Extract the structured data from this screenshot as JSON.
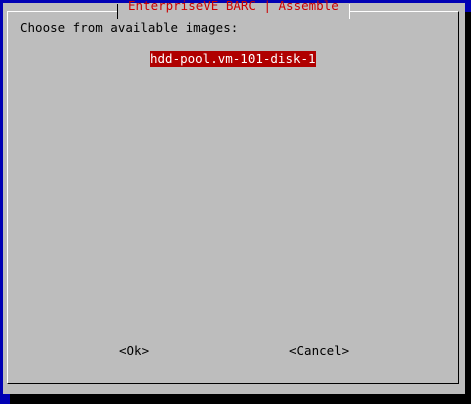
{
  "dialog": {
    "title": "EnterpriseVE BARC | Assemble",
    "prompt": "Choose from available images:",
    "list": {
      "items": [
        {
          "label": "hdd-pool.vm-101-disk-1",
          "selected": true
        }
      ]
    },
    "buttons": {
      "ok_label": "<Ok>",
      "cancel_label": "<Cancel>"
    }
  },
  "colors": {
    "background": "#0000b4",
    "dialog": "#bdbdbd",
    "title_text": "#cc0000",
    "selection": "#b00000",
    "shadow": "#000000"
  }
}
